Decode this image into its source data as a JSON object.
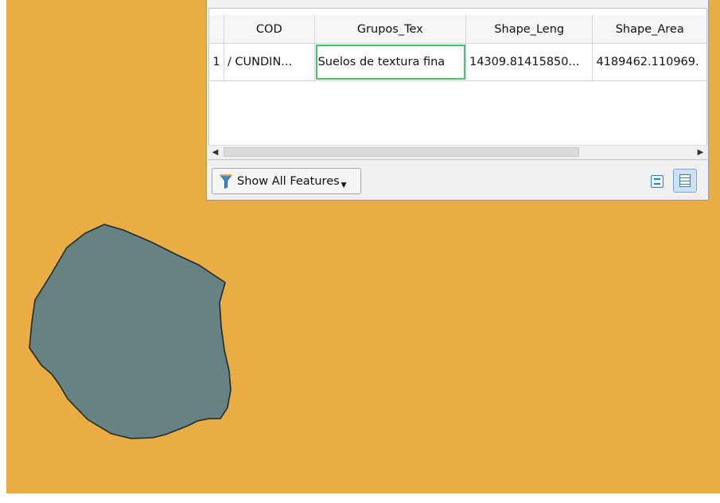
{
  "table": {
    "columns": [
      "COD",
      "Grupos_Tex",
      "Shape_Leng",
      "Shape_Area"
    ],
    "rows": [
      {
        "index": "1",
        "cod": "/ CUNDIN...",
        "grupos_tex": "Suelos de textura fina",
        "shape_leng": "14309.81415850...",
        "shape_area": "4189462.110969."
      }
    ]
  },
  "toolbar": {
    "filter_label": "Show All Features",
    "filter_icon": "filter-icon",
    "view_form_icon": "form-view-icon",
    "view_table_icon": "table-view-icon"
  },
  "colors": {
    "map_background": "#e9ad44",
    "polygon_fill": "#668283",
    "selection_outline": "#4fbf6f"
  }
}
